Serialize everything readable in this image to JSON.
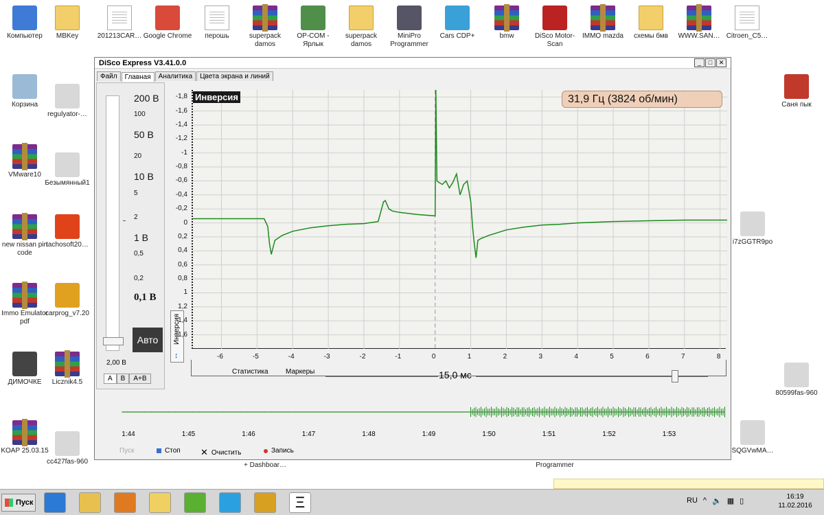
{
  "desktop": {
    "icons": [
      {
        "label": "Компьютер",
        "icon": "computer-icon"
      },
      {
        "label": "MBKey",
        "icon": "folder-icon"
      },
      {
        "label": "201213CAR…",
        "icon": "document-icon"
      },
      {
        "label": "Google Chrome",
        "icon": "chrome-icon"
      },
      {
        "label": "перошь",
        "icon": "document-icon"
      },
      {
        "label": "superpack damos",
        "icon": "winrar-icon"
      },
      {
        "label": "OP-COM - Ярлык",
        "icon": "opcom-icon"
      },
      {
        "label": "superpack damos",
        "icon": "folder-icon"
      },
      {
        "label": "MiniPro Programmer",
        "icon": "minipro-icon"
      },
      {
        "label": "Cars CDP+",
        "icon": "car-icon"
      },
      {
        "label": "bmw",
        "icon": "winrar-icon"
      },
      {
        "label": "DiSco Motor-Scan",
        "icon": "mk-icon"
      },
      {
        "label": "IMMO mazda",
        "icon": "winrar-icon"
      },
      {
        "label": "схемы бмв",
        "icon": "folder-icon"
      },
      {
        "label": "WWW.SAN…",
        "icon": "winrar-icon"
      },
      {
        "label": "Citroen_C5…",
        "icon": "document-icon"
      },
      {
        "label": "Корзина",
        "icon": "recycle-bin-icon"
      },
      {
        "label": "regulyator-…",
        "icon": "image-icon"
      },
      {
        "label": "VMware10",
        "icon": "winrar-icon"
      },
      {
        "label": "Безымянный1",
        "icon": "image-icon"
      },
      {
        "label": "new nissan pin code",
        "icon": "winrar-icon"
      },
      {
        "label": "tachosoft20…",
        "icon": "snd-icon"
      },
      {
        "label": "Immo Emulator pdf",
        "icon": "winrar-icon"
      },
      {
        "label": "carprog_v7.20",
        "icon": "key-icon"
      },
      {
        "label": "ДИМОЧКЕ",
        "icon": "video-icon"
      },
      {
        "label": "Licznik4.5",
        "icon": "winrar-icon"
      },
      {
        "label": "KOAP 25.03.15",
        "icon": "winrar-icon"
      },
      {
        "label": "cc427fas-960",
        "icon": "image-icon"
      },
      {
        "label": "Саня пык",
        "icon": "pdf-icon"
      },
      {
        "label": "i7zGGTR9po",
        "icon": "image-icon"
      },
      {
        "label": "80599fas-960",
        "icon": "image-icon"
      },
      {
        "label": "SQGVwMA…",
        "icon": "image-icon"
      }
    ],
    "partial_labels": [
      "+ Dashboar…",
      "Programmer"
    ]
  },
  "window": {
    "title": "DiSco Express V3.41.0.0",
    "menu_tabs": [
      "Файл",
      "Главная",
      "Аналитика",
      "Цвета экрана и линий"
    ],
    "active_tab": "Главная",
    "voltage_scale": [
      "200 В",
      "100",
      "50 В",
      "20",
      "10 В",
      "5",
      "2",
      "1 В",
      "0,5",
      "0,2",
      "0,1 В"
    ],
    "auto_button": "Авто",
    "current_range": "2,00 В",
    "channel_tabs": [
      "A",
      "B",
      "A+B"
    ],
    "active_channel": "A",
    "inversion_side": "Инверсия",
    "inversion_label": "Инверсия",
    "frequency_readout": "31,9 Гц (3824 об/мин)",
    "statistics_label": "Статистика",
    "markers_label": "Маркеры",
    "timebase": "15,0 мс",
    "controls": {
      "start": "Пуск",
      "stop": "Стоп",
      "clear": "Очистить",
      "record": "Запись"
    },
    "overview_times": [
      "1:44",
      "1:45",
      "1:46",
      "1:47",
      "1:48",
      "1:49",
      "1:50",
      "1:51",
      "1:52",
      "1:53"
    ]
  },
  "chart_data": {
    "type": "line",
    "title": "",
    "xlabel": "",
    "ylabel": "",
    "xlim": [
      -6.8,
      8.2
    ],
    "ylim": [
      1.8,
      -1.9
    ],
    "x_ticks": [
      -6,
      -5,
      -4,
      -3,
      -2,
      -1,
      0,
      1,
      2,
      3,
      4,
      5,
      6,
      7,
      8
    ],
    "y_ticks": [
      "-1,8",
      "-1,6",
      "-1,4",
      "-1,2",
      "-1",
      "-0,8",
      "-0,6",
      "-0,4",
      "-0,2",
      "0",
      "0,2",
      "0,4",
      "0,6",
      "0,8",
      "1",
      "1,2",
      "1,4",
      "1,6"
    ],
    "y_tick_values": [
      -1.8,
      -1.6,
      -1.4,
      -1.2,
      -1,
      -0.8,
      -0.6,
      -0.4,
      -0.2,
      0,
      0.2,
      0.4,
      0.6,
      0.8,
      1,
      1.2,
      1.4,
      1.6
    ],
    "grid": true,
    "series_color": "#1a8a1a",
    "series": [
      {
        "name": "",
        "x": [
          -6.8,
          -4.8,
          -4.7,
          -4.65,
          -4.6,
          -4.5,
          -4.3,
          -4.0,
          -3.5,
          -3.0,
          -2.5,
          -2.0,
          -1.6,
          -1.45,
          -1.4,
          -1.3,
          -1.2,
          -1.0,
          -0.5,
          0.0,
          0.02,
          0.05,
          0.1,
          0.2,
          0.3,
          0.4,
          0.5,
          0.6,
          0.7,
          0.8,
          0.9,
          1.0,
          1.05,
          1.1,
          1.15,
          1.2,
          1.3,
          1.5,
          2.0,
          2.5,
          3.0,
          3.5,
          4.0,
          5.0,
          6.0,
          7.0,
          8.2
        ],
        "y": [
          -0.06,
          -0.06,
          0.05,
          0.3,
          0.45,
          0.25,
          0.18,
          0.12,
          0.07,
          0.04,
          0.02,
          0.01,
          -0.02,
          -0.3,
          -0.32,
          -0.2,
          -0.17,
          -0.15,
          -0.12,
          -0.1,
          -1.94,
          -0.6,
          -0.58,
          -0.55,
          -0.6,
          -0.5,
          -0.58,
          -0.7,
          -0.4,
          -0.55,
          -0.6,
          -0.3,
          0.05,
          0.3,
          0.5,
          0.25,
          0.22,
          0.18,
          0.1,
          0.06,
          0.03,
          0.02,
          0.0,
          -0.02,
          -0.03,
          -0.04,
          -0.04
        ]
      }
    ]
  },
  "taskbar": {
    "start_label": "Пуск",
    "language": "RU",
    "time": "16:19",
    "date": "11.02.2016",
    "apps": [
      "ie-icon",
      "explorer-icon",
      "media-icon",
      "folder-icon",
      "icq-icon",
      "skype-icon",
      "disco-icon",
      "xi-icon"
    ]
  }
}
